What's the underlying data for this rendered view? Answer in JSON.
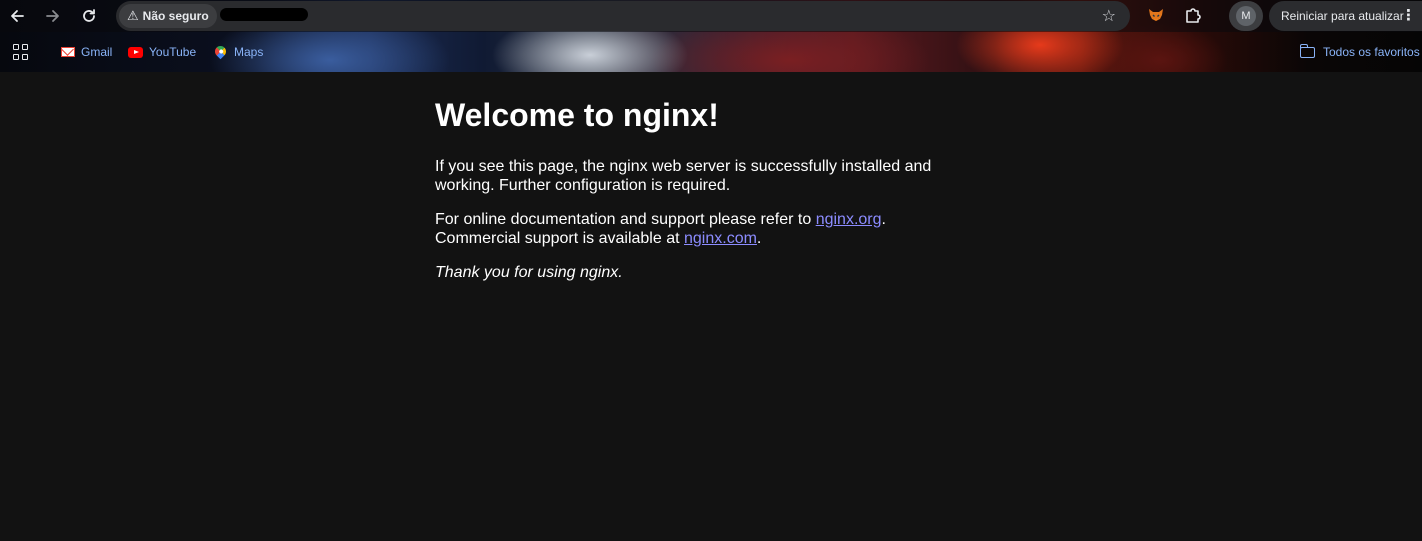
{
  "browser": {
    "nav": {
      "back_icon": "arrow-left-icon",
      "forward_icon": "arrow-right-icon",
      "reload_icon": "reload-icon"
    },
    "omnibox": {
      "security_label": "Não seguro",
      "security_icon": "warning-triangle-icon",
      "bookmark_star_icon": "star-icon"
    },
    "extensions": {
      "fox_icon": "fox-extension-icon",
      "puzzle_icon": "extensions-puzzle-icon"
    },
    "profile": {
      "avatar_letter": "M"
    },
    "update_button_label": "Reiniciar para atualizar",
    "menu_icon": "more-vertical-icon"
  },
  "bookmarks": {
    "apps_icon": "apps-grid-icon",
    "items": [
      {
        "label": "Gmail",
        "icon": "gmail-icon"
      },
      {
        "label": "YouTube",
        "icon": "youtube-icon"
      },
      {
        "label": "Maps",
        "icon": "maps-pin-icon"
      }
    ],
    "all_bookmarks_label": "Todos os favoritos",
    "all_bookmarks_icon": "folder-icon"
  },
  "page": {
    "heading": "Welcome to nginx!",
    "para1": "If you see this page, the nginx web server is successfully installed and working. Further configuration is required.",
    "para2_prefix": "For online documentation and support please refer to ",
    "para2_link1": "nginx.org",
    "para2_middle": ". Commercial support is available at ",
    "para2_link2": "nginx.com",
    "para2_suffix": ".",
    "thanks": "Thank you for using nginx.",
    "link_color": "#8c8cff",
    "background_color": "#121212"
  }
}
